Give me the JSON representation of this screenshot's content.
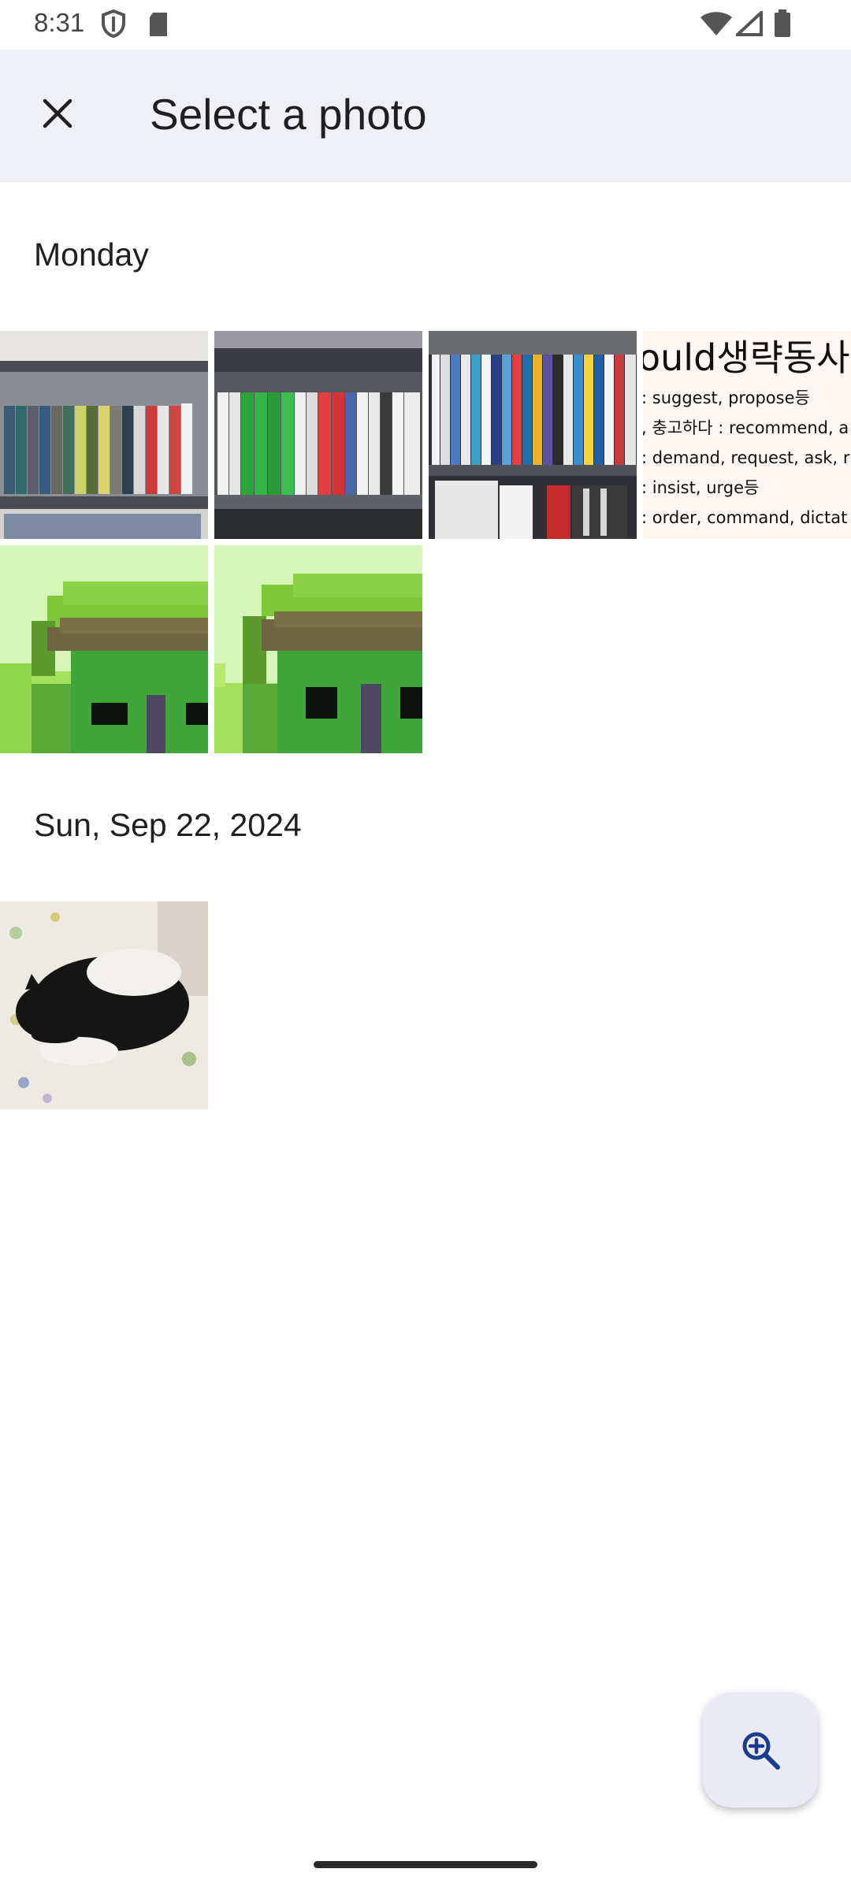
{
  "status_bar": {
    "time": "8:31",
    "icons_left": [
      "shield-icon",
      "sd-card-icon"
    ],
    "icons_right": [
      "wifi-icon",
      "signal-icon",
      "battery-icon"
    ]
  },
  "app_bar": {
    "close_icon": "close-icon",
    "title": "Select a photo"
  },
  "sections": [
    {
      "title": "Monday",
      "photos": [
        {
          "name": "photo-bookshelf-1",
          "icon": "bookshelf-photo"
        },
        {
          "name": "photo-bookshelf-2",
          "icon": "bookshelf-photo"
        },
        {
          "name": "photo-bookshelf-3",
          "icon": "bookshelf-photo"
        },
        {
          "name": "photo-korean-text",
          "icon": "text-note-photo",
          "text_lines": [
            "ould생략동사",
            ": suggest, propose등",
            ", 충고하다 : recommend, a",
            ": demand, request, ask, r",
            ": insist, urge등",
            ": order, command, dictat"
          ]
        },
        {
          "name": "photo-pixel-house-1",
          "icon": "pixel-house-photo"
        },
        {
          "name": "photo-pixel-house-2",
          "icon": "pixel-house-photo"
        }
      ]
    },
    {
      "title": "Sun, Sep 22, 2024",
      "photos": [
        {
          "name": "photo-cat-on-bed",
          "icon": "cat-photo"
        }
      ]
    }
  ],
  "fab": {
    "icon": "zoom-in-icon"
  },
  "colors": {
    "app_bar_bg": "#eff0f5",
    "fab_bg": "#e9eaf6",
    "fab_icon": "#1a3c8c"
  }
}
